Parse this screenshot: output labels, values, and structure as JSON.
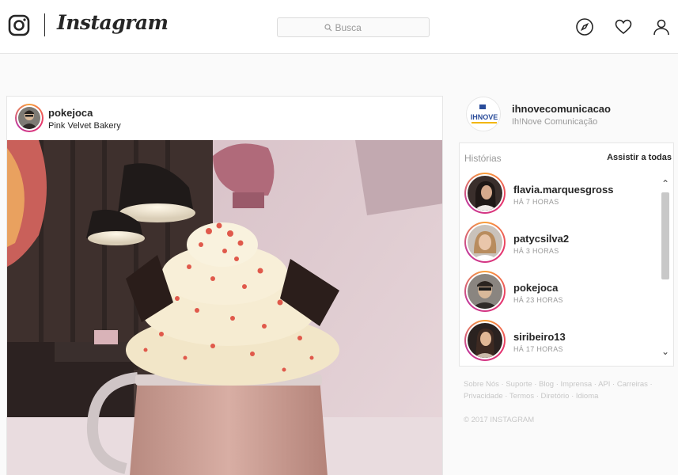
{
  "header": {
    "wordmark": "Instagram",
    "search": {
      "placeholder": "Busca"
    },
    "nav_icons": [
      "explore-compass-icon",
      "activity-heart-icon",
      "profile-person-icon"
    ]
  },
  "post": {
    "username": "pokejoca",
    "location": "Pink Velvet Bakery"
  },
  "sidebar": {
    "profile": {
      "username": "ihnovecomunicacao",
      "full_name": "Ih!Nove Comunicação",
      "avatar_text": "IHNOVE"
    },
    "stories": {
      "title": "Histórias",
      "watch_all": "Assistir a todas",
      "items": [
        {
          "username": "flavia.marquesgross",
          "time": "HÁ 7 HORAS"
        },
        {
          "username": "patycsilva2",
          "time": "HÁ 3 HORAS"
        },
        {
          "username": "pokejoca",
          "time": "HÁ 23 HORAS"
        },
        {
          "username": "siribeiro13",
          "time": "HÁ 17 HORAS"
        }
      ]
    },
    "footer_links": [
      "Sobre Nós",
      "Suporte",
      "Blog",
      "Imprensa",
      "API",
      "Carreiras",
      "Privacidade",
      "Termos",
      "Diretório",
      "Idioma"
    ],
    "copyright": "© 2017 INSTAGRAM"
  },
  "colors": {
    "story_ring": "#e5316d",
    "border": "#e6e6e6",
    "muted_text": "#999999"
  }
}
